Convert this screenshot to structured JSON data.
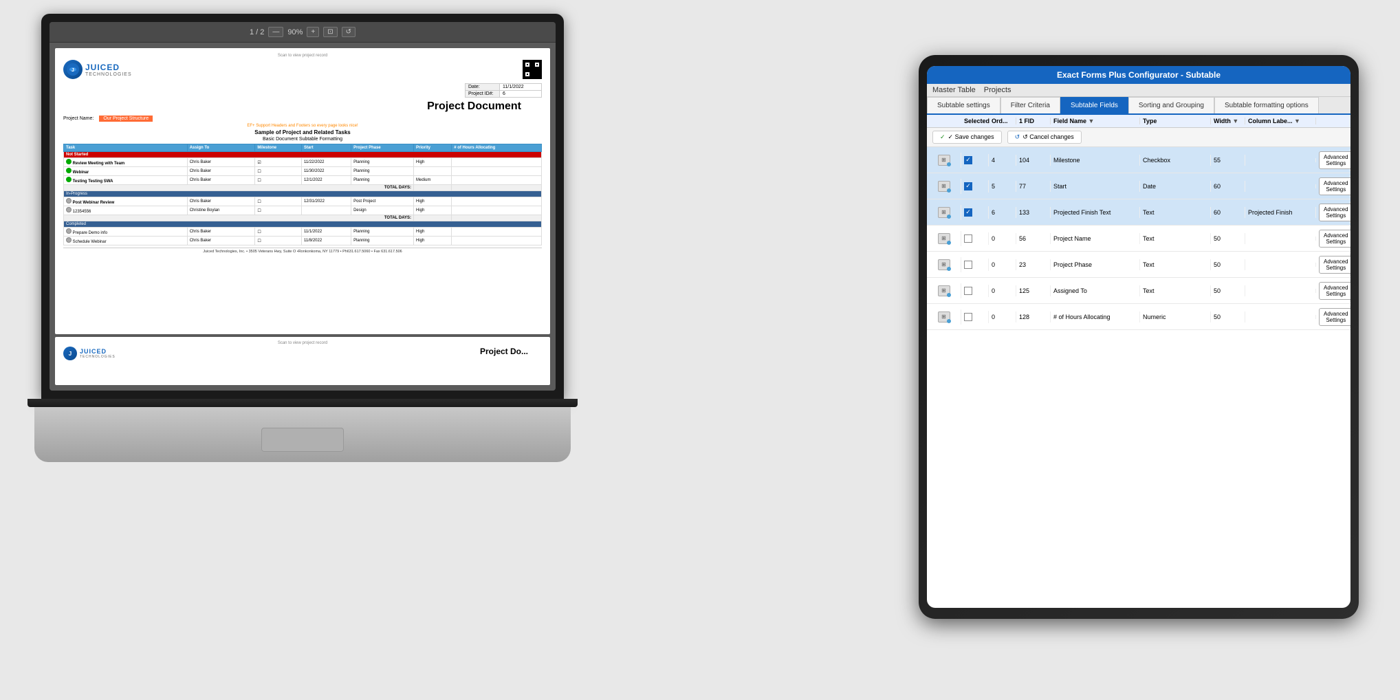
{
  "background_color": "#e8e8e8",
  "laptop": {
    "toolbar": {
      "page_info": "1 / 2",
      "zoom": "90%",
      "minus": "—",
      "plus": "+"
    },
    "document": {
      "link_text": "Scan to view project record",
      "title": "Project Document",
      "logo_name": "JUICED",
      "logo_sub": "TECHNOLOGIES",
      "date_label": "Date:",
      "date_value": "11/1/2022",
      "project_id_label": "Project ID#:",
      "project_id_value": "6",
      "project_name_label": "Project Name:",
      "project_name_value": "Our Project Structure",
      "ef_note": "EF+ Support Headers and Footers so every page looks nice!",
      "subtitle1": "Sample of Project and Related Tasks",
      "subtitle2": "Basic Document Subtable Formatting",
      "table_headers": [
        "Task",
        "Assign To",
        "Milestone",
        "Start",
        "Project Phase",
        "Priority",
        "# of Hours Allocating"
      ],
      "sections": [
        {
          "name": "Not Started",
          "color": "#cc0000",
          "rows": [
            {
              "task": "Review Meeting with Team",
              "assign": "Chris Baker",
              "milestone": "☑",
              "start": "11/22/2022",
              "phase": "Planning",
              "priority": "High"
            },
            {
              "task": "Webinar",
              "assign": "Chris Baker",
              "milestone": "☐",
              "start": "11/30/2022",
              "phase": "Planning",
              "priority": ""
            },
            {
              "task": "Testing Testing SWA",
              "assign": "Chris Baker",
              "milestone": "☐",
              "start": "12/1/2022",
              "phase": "Planning",
              "priority": "Medium"
            }
          ]
        },
        {
          "name": "In-Progress",
          "color": "#366092",
          "rows": [
            {
              "task": "Post Webinar Review",
              "assign": "Chris Baker",
              "milestone": "☐",
              "start": "12/31/2022",
              "phase": "Post Project",
              "priority": "High"
            },
            {
              "task": "12354556",
              "assign": "Christine Boylan",
              "milestone": "☐",
              "start": "",
              "phase": "Design",
              "priority": "High"
            }
          ]
        },
        {
          "name": "Completed",
          "color": "#366092",
          "rows": [
            {
              "task": "Prepare Demo info",
              "assign": "Chris Baker",
              "milestone": "☐",
              "start": "11/1/2022",
              "phase": "Planning",
              "priority": "High"
            },
            {
              "task": "Schedule Webinar",
              "assign": "Chris Baker",
              "milestone": "☐",
              "start": "11/8/2022",
              "phase": "Planning",
              "priority": "High"
            }
          ]
        }
      ],
      "footer": "Juiced Technologies, Inc.  •  3505 Veterans Hwy, Suite O  •Ronkonkoma, NY 11779  •  Ph631.617.5060  •  Fax 631.617.506"
    }
  },
  "tablet": {
    "titlebar": "Exact Forms Plus Configurator - Subtable",
    "menu_items": [
      "Master Table",
      "Projects"
    ],
    "tabs": [
      {
        "label": "Subtable settings",
        "active": false
      },
      {
        "label": "Filter Criteria",
        "active": false
      },
      {
        "label": "Subtable Fields",
        "active": true
      },
      {
        "label": "Sorting and Grouping",
        "active": false
      },
      {
        "label": "Subtable formatting options",
        "active": false
      }
    ],
    "table_headers": {
      "col1": "",
      "col2": "Selected",
      "col3": "Ord...",
      "col4": "1 FID",
      "col5": "Field Name",
      "col6": "Type",
      "col7": "Width",
      "col8": "Column Labe...",
      "col9": ""
    },
    "action_buttons": {
      "save": "✓ Save changes",
      "cancel": "↺ Cancel changes"
    },
    "rows": [
      {
        "ord": "4",
        "fid": "104",
        "field_name": "Milestone",
        "type": "Checkbox",
        "width": "55",
        "column_label": "",
        "selected": true,
        "advanced_label": "Advanced Settings"
      },
      {
        "ord": "5",
        "fid": "77",
        "field_name": "Start",
        "type": "Date",
        "width": "60",
        "column_label": "",
        "selected": true,
        "advanced_label": "Advanced Settings"
      },
      {
        "ord": "6",
        "fid": "133",
        "field_name": "Projected Finish Text",
        "type": "Text",
        "width": "60",
        "column_label": "Projected Finish",
        "selected": true,
        "advanced_label": "Advanced Settings"
      },
      {
        "ord": "0",
        "fid": "56",
        "field_name": "Project Name",
        "type": "Text",
        "width": "50",
        "column_label": "",
        "selected": false,
        "advanced_label": "Advanced Settings"
      },
      {
        "ord": "0",
        "fid": "23",
        "field_name": "Project Phase",
        "type": "Text",
        "width": "50",
        "column_label": "",
        "selected": false,
        "advanced_label": "Advanced Settings"
      },
      {
        "ord": "0",
        "fid": "125",
        "field_name": "Assigned To",
        "type": "Text",
        "width": "50",
        "column_label": "",
        "selected": false,
        "advanced_label": "Advanced Settings"
      },
      {
        "ord": "0",
        "fid": "128",
        "field_name": "# of Hours Allocating",
        "type": "Numeric",
        "width": "50",
        "column_label": "",
        "selected": false,
        "advanced_label": "Advanced Settings"
      }
    ]
  }
}
